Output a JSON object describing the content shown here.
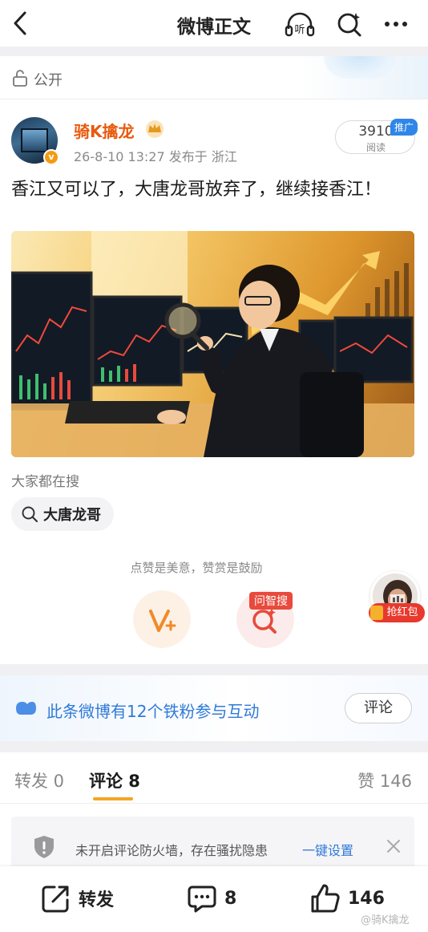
{
  "topbar": {
    "title": "微博正文",
    "back_icon": "chevron-left-icon",
    "listen_label": "听",
    "ask_icon": "ai-search-icon",
    "more_icon": "more-dots-icon"
  },
  "visibility": {
    "label": "公开"
  },
  "author": {
    "name": "骑K擒龙",
    "meta": "26-8-10 13:27  发布于 浙江",
    "reads": "3910",
    "reads_label": "阅读",
    "promo_badge": "推广",
    "verified_badge": "v"
  },
  "post": {
    "text": "香江又可以了，大唐龙哥放弃了，继续接香江！",
    "image_desc_icon": "stock-trader-illustration"
  },
  "search": {
    "label": "大家都在搜",
    "chip": "大唐龙哥"
  },
  "actions": {
    "hint": "点赞是美意，赞赏是鼓励",
    "ask_tag": "问智搜"
  },
  "floating": {
    "red_packet": "抢红包"
  },
  "fans": {
    "text": "此条微博有12个铁粉参与互动",
    "button": "评论"
  },
  "tabs": {
    "forward": "转发 0",
    "comments": "评论 8",
    "likes": "赞 146"
  },
  "firewall": {
    "text": "未开启评论防火墙，存在骚扰隐患",
    "link": "一键设置"
  },
  "bottom": {
    "forward": "转发",
    "comments": "8",
    "likes": "146"
  },
  "watermark": "@骑K擒龙",
  "colors": {
    "accent_orange": "#e8590c",
    "link_blue": "#2f7ad8",
    "tab_underline": "#f3a623",
    "red": "#e84a3c"
  }
}
